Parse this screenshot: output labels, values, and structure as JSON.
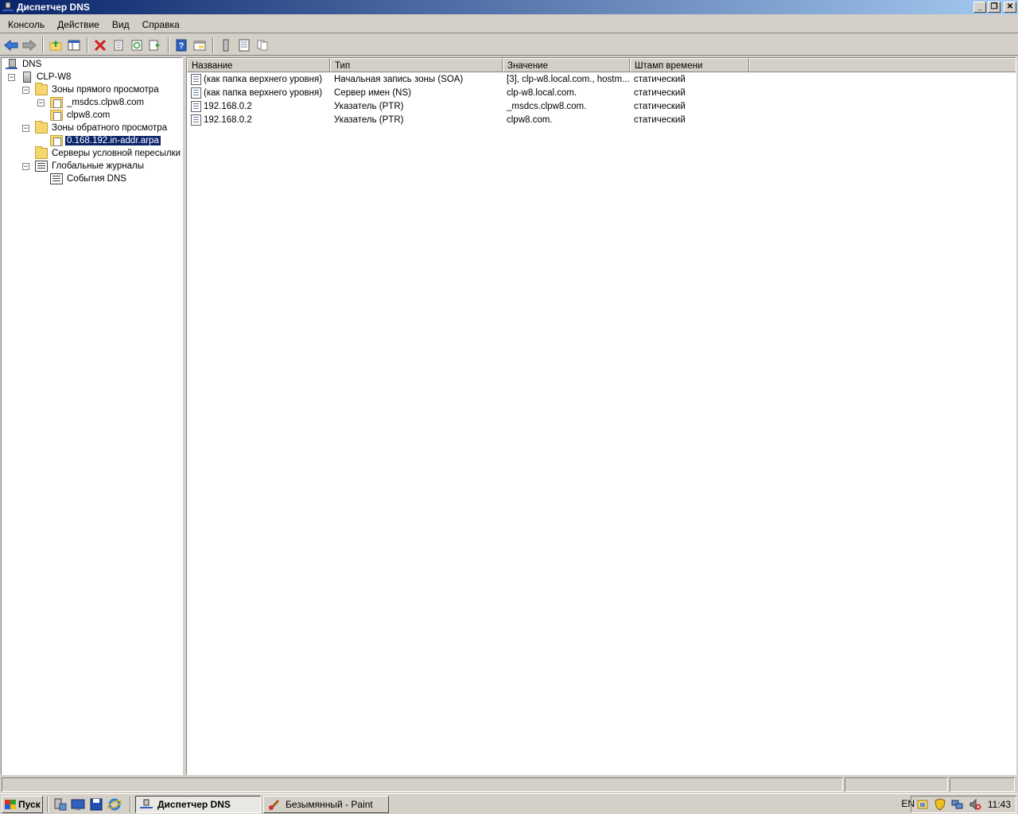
{
  "window": {
    "title": "Диспетчер DNS",
    "controls": {
      "minimize": "_",
      "restore": "❐",
      "close": "✕"
    }
  },
  "menu": [
    "Консоль",
    "Действие",
    "Вид",
    "Справка"
  ],
  "toolbar": {
    "icons": [
      "back-arrow-icon",
      "forward-arrow-icon",
      "up-folder-icon",
      "show-hide-tree-icon",
      "delete-icon",
      "properties-icon",
      "refresh-icon",
      "export-list-icon",
      "help-icon",
      "show-console-tree-icon",
      "server-icon",
      "record-list-icon",
      "copy-icon"
    ]
  },
  "tree": {
    "root": "DNS",
    "server": "CLP-W8",
    "forward_zones": "Зоны прямого просмотра",
    "forward_zone_items": [
      "_msdcs.clpw8.com",
      "clpw8.com"
    ],
    "reverse_zones": "Зоны обратного просмотра",
    "reverse_zone_items": [
      "0.168.192.in-addr.arpa"
    ],
    "conditional_forwarders": "Серверы условной пересылки",
    "global_logs": "Глобальные журналы",
    "dns_events": "События DNS"
  },
  "list": {
    "columns": [
      "Название",
      "Тип",
      "Значение",
      "Штамп времени"
    ],
    "rows": [
      [
        "(как папка верхнего уровня)",
        "Начальная запись зоны (SOA)",
        "[3], clp-w8.local.com., hostm...",
        "статический"
      ],
      [
        "(как папка верхнего уровня)",
        "Сервер имен (NS)",
        "clp-w8.local.com.",
        "статический"
      ],
      [
        "192.168.0.2",
        "Указатель (PTR)",
        "_msdcs.clpw8.com.",
        "статический"
      ],
      [
        "192.168.0.2",
        "Указатель (PTR)",
        "clpw8.com.",
        "статический"
      ]
    ]
  },
  "taskbar": {
    "start": "Пуск",
    "tasks": [
      {
        "label": "Диспетчер DNS",
        "active": true
      },
      {
        "label": "Безымянный - Paint",
        "active": false
      }
    ],
    "language": "EN",
    "clock": "11:43"
  },
  "colors": {
    "title_gradient_start": "#0a246a",
    "title_gradient_end": "#a6caf0",
    "selection": "#0a246a",
    "face": "#d4d0c8"
  }
}
